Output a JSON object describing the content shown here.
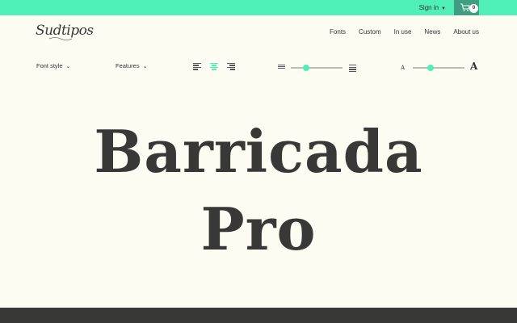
{
  "colors": {
    "accent": "#4ef0b8",
    "cart_bg": "#3f9e82",
    "text": "#333333",
    "footer": "#383836"
  },
  "topbar": {
    "signin_label": "Sign in",
    "cart_count": "0"
  },
  "logo": {
    "text": "Sudtipos"
  },
  "nav": {
    "items": [
      "Fonts",
      "Custom",
      "In use",
      "News",
      "About us"
    ]
  },
  "controls": {
    "font_style_label": "Font style",
    "features_label": "Features",
    "alignment": "center",
    "line_height_level": 0.3,
    "size_level": 0.35,
    "size_small_glyph": "A",
    "size_big_glyph": "A"
  },
  "headline": {
    "line1": "Barricada",
    "line2": "Pro"
  }
}
